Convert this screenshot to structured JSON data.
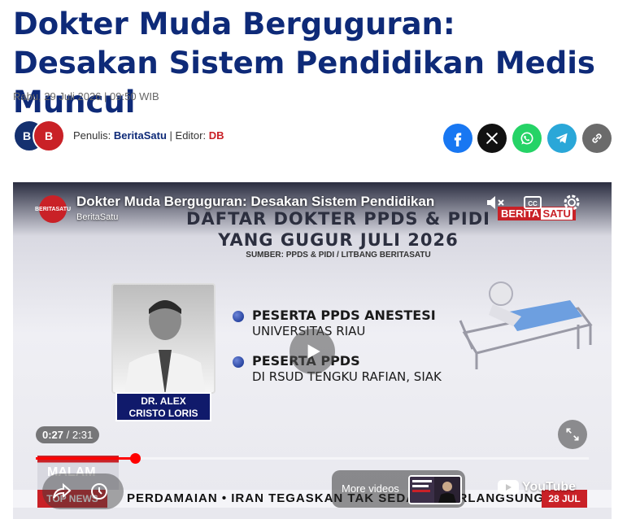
{
  "article": {
    "title": "Dokter Muda Berguguran: Desakan Sistem Pendidikan Medis Muncul",
    "date": "Rabu, 29 Juli 2026 | 09:50 WIB",
    "avatar_initials": [
      "B",
      "B"
    ],
    "writer_label": "Penulis:",
    "writer": "BeritaSatu",
    "editor_label": "| Editor:",
    "editor": "DB"
  },
  "share": {
    "icons": [
      "facebook-icon",
      "x-icon",
      "whatsapp-icon",
      "telegram-icon",
      "link-icon"
    ],
    "colors": {
      "facebook": "#1877f2",
      "x": "#111111",
      "whatsapp": "#25d366",
      "telegram": "#2aa7d8",
      "link": "#6b6b6b"
    }
  },
  "video": {
    "title": "Dokter Muda Berguguran: Desakan Sistem Pendidikan",
    "channel": "BeritaSatu",
    "channel_logo_text": "BERITASATU",
    "watermark_1": "BERITA",
    "watermark_2": "SATU",
    "current_time": "0:27",
    "separator": "/",
    "duration": "2:31",
    "progress": 0.179,
    "more_videos_label": "More videos",
    "youtube_label": "YouTube",
    "frame": {
      "heading_line1": "DAFTAR DOKTER PPDS & PIDI",
      "heading_line2": "YANG GUGUR JULI 2026",
      "source": "SUMBER: PPDS & PIDI / LITBANG BERITASATU",
      "name_line1": "DR. ALEX",
      "name_line2": "CRISTO LORIS",
      "item1_line1": "PESERTA PPDS ANESTESI",
      "item1_line2": "UNIVERSITAS RIAU",
      "item2_line1": "PESERTA PPDS",
      "item2_line2": "DI RSUD TENGKU RAFIAN, SIAK",
      "segment": "MALAM",
      "ticker_label": "TOP NEWS",
      "ticker_text": "PERDAMAIAN  •  IRAN TEGASKAN TAK SEDANG BERLANGSUNGKA",
      "ticker_date": "28 JUL"
    }
  },
  "colors": {
    "title": "#0e2a78",
    "brand_red": "#c92127",
    "progress": "#ff0000"
  }
}
